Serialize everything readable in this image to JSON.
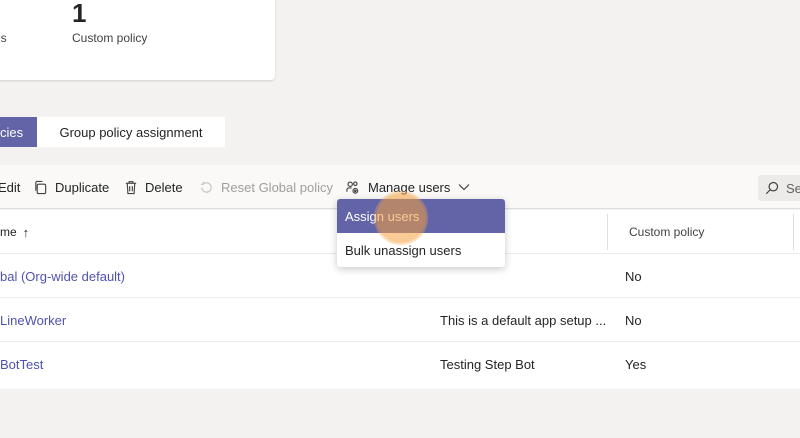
{
  "summary": {
    "stat_a_label": "licies",
    "stat_b_value": "1",
    "stat_b_label": "Custom policy"
  },
  "tabs": [
    {
      "label": "cies",
      "active": true
    },
    {
      "label": "Group policy assignment",
      "active": false
    }
  ],
  "toolbar": {
    "edit_label": "Edit",
    "duplicate_label": "Duplicate",
    "delete_label": "Delete",
    "reset_label": "Reset Global policy",
    "manage_label": "Manage users",
    "search_placeholder": "Se"
  },
  "table": {
    "headers": {
      "name": "me",
      "custom": "Custom policy"
    },
    "rows": [
      {
        "name": "bal (Org-wide default)",
        "description": "",
        "custom": "No"
      },
      {
        "name": "LineWorker",
        "description": "This is a default app setup ...",
        "custom": "No"
      },
      {
        "name": "BotTest",
        "description": "Testing Step Bot",
        "custom": "Yes"
      }
    ]
  },
  "manage_menu": {
    "items": [
      "Assign users",
      "Bulk unassign users"
    ],
    "highlighted": "Assign users"
  },
  "colors": {
    "accent": "#6264a7",
    "link": "#4f52b2",
    "click_highlight": "#f5a03c"
  },
  "icons": {
    "edit": "edit-icon",
    "duplicate": "duplicate-icon",
    "delete": "trash-icon",
    "reset": "reset-icon",
    "manage": "people-settings-icon",
    "chevron": "chevron-down-icon",
    "search": "search-icon",
    "sort": "sort-ascending-icon"
  }
}
